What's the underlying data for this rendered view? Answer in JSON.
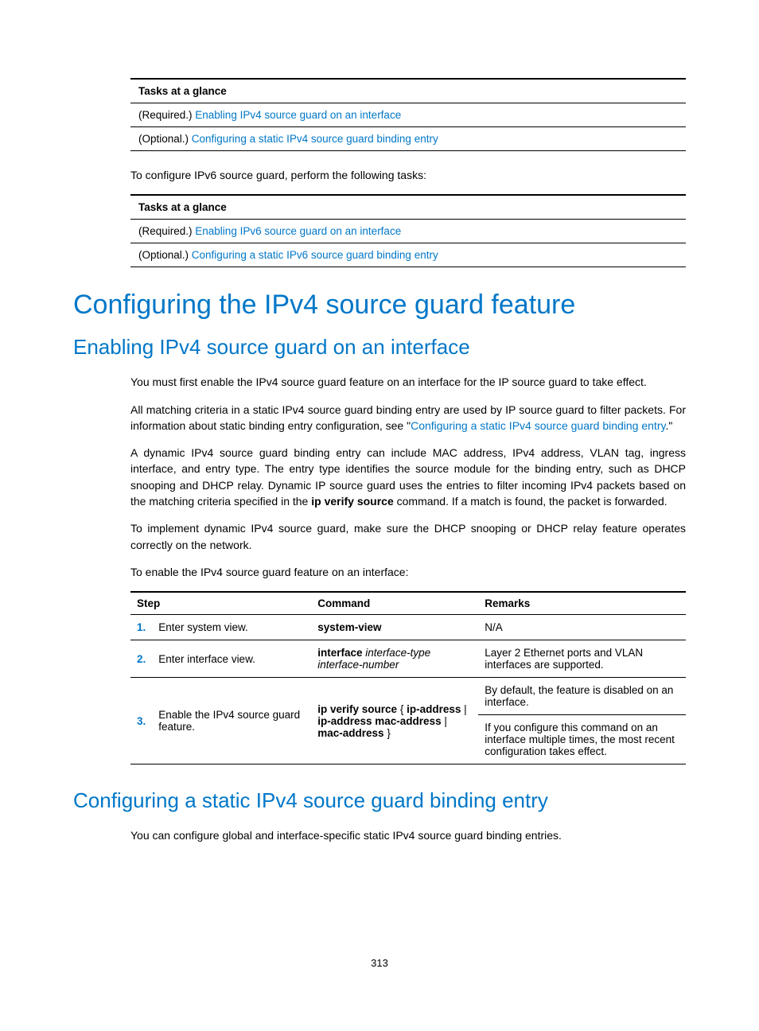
{
  "table1": {
    "header": "Tasks at a glance",
    "row1_prefix": "(Required.) ",
    "row1_link": "Enabling IPv4 source guard on an interface",
    "row2_prefix": "(Optional.) ",
    "row2_link": "Configuring a static IPv4 source guard binding entry"
  },
  "intro1": "To configure IPv6 source guard, perform the following tasks:",
  "table2": {
    "header": "Tasks at a glance",
    "row1_prefix": "(Required.) ",
    "row1_link": "Enabling IPv6 source guard on an interface",
    "row2_prefix": "(Optional.) ",
    "row2_link": "Configuring a static IPv6 source guard binding entry"
  },
  "h1": "Configuring the IPv4 source guard feature",
  "h2a": "Enabling IPv4 source guard on an interface",
  "p1": "You must first enable the IPv4 source guard feature on an interface for the IP source guard to take effect.",
  "p2a": "All matching criteria in a static IPv4 source guard binding entry are used by IP source guard to filter packets. For information about static binding entry configuration, see \"",
  "p2link": "Configuring a static IPv4 source guard binding entry",
  "p2b": ".\"",
  "p3a": "A dynamic IPv4 source guard binding entry can include MAC address, IPv4 address, VLAN tag, ingress interface, and entry type. The entry type identifies the source module for the binding entry, such as DHCP snooping and DHCP relay. Dynamic IP source guard uses the entries to filter incoming IPv4 packets based on the matching criteria specified in the ",
  "p3bold": "ip verify source",
  "p3b": " command. If a match is found, the packet is forwarded.",
  "p4": "To implement dynamic IPv4 source guard, make sure the DHCP snooping or DHCP relay feature operates correctly on the network.",
  "p5": "To enable the IPv4 source guard feature on an interface:",
  "steps": {
    "col1": "Step",
    "col2": "Command",
    "col3": "Remarks",
    "r1": {
      "num": "1.",
      "desc": "Enter system view.",
      "cmd": "system-view",
      "rem": "N/A"
    },
    "r2": {
      "num": "2.",
      "desc": "Enter interface view.",
      "cmd_b": "interface",
      "cmd_i": " interface-type interface-number",
      "rem": "Layer 2 Ethernet ports and VLAN interfaces are supported."
    },
    "r3": {
      "num": "3.",
      "desc": "Enable the IPv4 source guard feature.",
      "cmd_1": "ip verify source",
      "cmd_2": " { ",
      "cmd_3": "ip-address",
      "cmd_4": " | ",
      "cmd_5": "ip-address mac-address",
      "cmd_6": " | ",
      "cmd_7": "mac-address",
      "cmd_8": " }",
      "rem1": "By default, the feature is disabled on an interface.",
      "rem2": "If you configure this command on an interface multiple times, the most recent configuration takes effect."
    }
  },
  "h2b": "Configuring a static IPv4 source guard binding entry",
  "p6": "You can configure global and interface-specific static IPv4 source guard binding entries.",
  "pagenum": "313"
}
